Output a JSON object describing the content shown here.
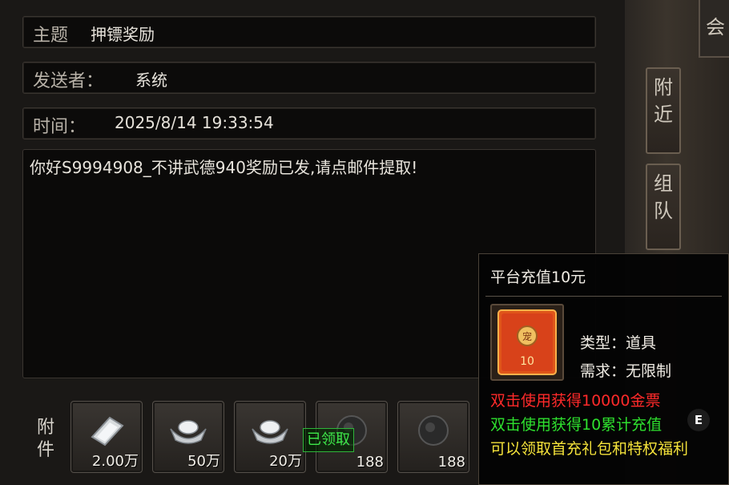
{
  "mail": {
    "subject_label": "主题",
    "subject_value": "押镖奖励",
    "sender_label": "发送者：",
    "sender_value": "系统",
    "time_label": "时间：",
    "time_value": "2025/8/14 19:33:54",
    "body": "你好S9994908_不讲武德940奖励已发,请点邮件提取!",
    "attachments_label": "附\n件",
    "attachments": [
      {
        "icon": "silver-ticket-icon",
        "count": "2.00万"
      },
      {
        "icon": "silver-ingot-icon",
        "count": "50万"
      },
      {
        "icon": "silver-ingot-icon",
        "count": "20万"
      },
      {
        "icon": "dark-orb-icon",
        "count": "188"
      },
      {
        "icon": "dark-orb-icon",
        "count": "188"
      }
    ],
    "claimed_badge": "已领取"
  },
  "side": {
    "top_tab": "会",
    "tab_nearby": "附近",
    "tab_team": "组队"
  },
  "tooltip": {
    "title": "平台充值10元",
    "icon_number": "10",
    "icon_seal": "宠",
    "type_label": "类型：",
    "type_value": "道具",
    "req_label": "需求：",
    "req_value": "无限制",
    "line1": "双击使用获得10000金票",
    "line2": "双击使用获得10累计充值",
    "line3": "可以领取首充礼包和特权福利",
    "badge": "E"
  },
  "colors": {
    "line1": "#ff2a2a",
    "line2": "#2ee02e",
    "line3": "#f4e23a",
    "claimed": "#3ee84a"
  }
}
